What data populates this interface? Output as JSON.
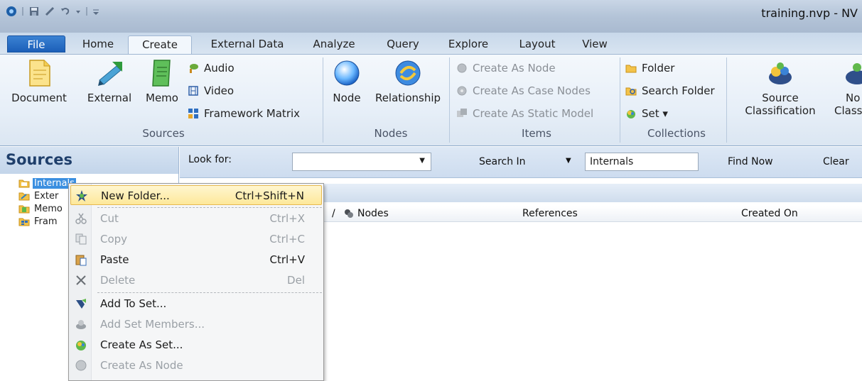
{
  "window": {
    "title": "training.nvp - NV"
  },
  "tabs": [
    {
      "label": "File"
    },
    {
      "label": "Home"
    },
    {
      "label": "Create"
    },
    {
      "label": "External Data"
    },
    {
      "label": "Analyze"
    },
    {
      "label": "Query"
    },
    {
      "label": "Explore"
    },
    {
      "label": "Layout"
    },
    {
      "label": "View"
    }
  ],
  "ribbon": {
    "sources": {
      "label": "Sources",
      "document": "Document",
      "external": "External",
      "memo": "Memo",
      "audio": "Audio",
      "video": "Video",
      "framework_matrix": "Framework Matrix"
    },
    "nodes": {
      "label": "Nodes",
      "node": "Node",
      "relationship": "Relationship"
    },
    "items": {
      "label": "Items",
      "create_as_node": "Create As Node",
      "create_as_case_nodes": "Create As Case Nodes",
      "create_as_static_model": "Create As Static Model"
    },
    "collections": {
      "label": "Collections",
      "folder": "Folder",
      "search_folder": "Search Folder",
      "set": "Set ▾"
    },
    "classifications": {
      "source_line1": "Source",
      "source_line2": "Classification",
      "node_line1": "No",
      "node_line2": "Classif"
    }
  },
  "sources_pane": {
    "title": "Sources",
    "tree": [
      {
        "label": "Internals",
        "selected": true
      },
      {
        "label": "Exter"
      },
      {
        "label": "Memo"
      },
      {
        "label": "Fram"
      }
    ]
  },
  "findbar": {
    "look_for_label": "Look for:",
    "look_for_value": "",
    "search_in_label": "Search In",
    "search_in_value": "Internals",
    "find_now": "Find Now",
    "clear": "Clear"
  },
  "columns": {
    "sort_indicator": "/",
    "nodes": "Nodes",
    "references": "References",
    "created_on": "Created On"
  },
  "context_menu": [
    {
      "label": "New Folder...",
      "shortcut": "Ctrl+Shift+N",
      "highlight": true
    },
    {
      "label": "Cut",
      "shortcut": "Ctrl+X",
      "disabled": true
    },
    {
      "label": "Copy",
      "shortcut": "Ctrl+C",
      "disabled": true
    },
    {
      "label": "Paste",
      "shortcut": "Ctrl+V"
    },
    {
      "label": "Delete",
      "shortcut": "Del",
      "disabled": true
    },
    {
      "label": "Add To Set..."
    },
    {
      "label": "Add Set Members...",
      "disabled": true
    },
    {
      "label": "Create As Set..."
    },
    {
      "label": "Create As Node",
      "disabled": true
    }
  ],
  "colors": {
    "accent": "#1c5fb8",
    "selection": "#3b8fe0",
    "menu_highlight": "#fde89a"
  }
}
